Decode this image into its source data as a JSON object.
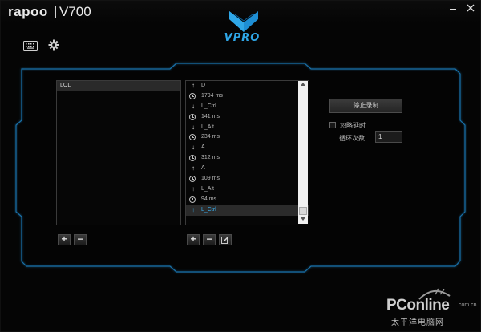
{
  "titlebar": {
    "brand": "rapoo",
    "model": "V700",
    "minimize_icon": "minimize-icon",
    "close_icon": "close-icon"
  },
  "logo": {
    "text": "VPRO"
  },
  "toolbar": {
    "icons": [
      "keyboard-icon",
      "gear-icon"
    ]
  },
  "macros": {
    "items": [
      {
        "label": "LOL",
        "selected": true
      }
    ]
  },
  "events": {
    "items": [
      {
        "type": "up",
        "label": "D"
      },
      {
        "type": "delay",
        "label": "1794  ms"
      },
      {
        "type": "down",
        "label": "L_Ctrl"
      },
      {
        "type": "delay",
        "label": "141  ms"
      },
      {
        "type": "down",
        "label": "L_Alt"
      },
      {
        "type": "delay",
        "label": "234  ms"
      },
      {
        "type": "down",
        "label": "A"
      },
      {
        "type": "delay",
        "label": "312  ms"
      },
      {
        "type": "up",
        "label": "A"
      },
      {
        "type": "delay",
        "label": "109  ms"
      },
      {
        "type": "up",
        "label": "L_Alt"
      },
      {
        "type": "delay",
        "label": "94  ms"
      },
      {
        "type": "up",
        "label": "L_Ctrl",
        "selected": true
      }
    ]
  },
  "buttons": {
    "add": "+",
    "remove": "−",
    "edit_icon": "edit-icon",
    "stop_recording": "停止录制"
  },
  "options": {
    "ignore_delay_label": "忽略延时",
    "ignore_delay_checked": false,
    "loop_label": "循环次数",
    "loop_value": "1"
  },
  "watermark": {
    "main": "PConline",
    "suffix": ".com.cn",
    "sub": "太平洋电脑网"
  },
  "colors": {
    "accent": "#2fa7e8",
    "frame": "#1a6fb0",
    "background": "#050505"
  }
}
